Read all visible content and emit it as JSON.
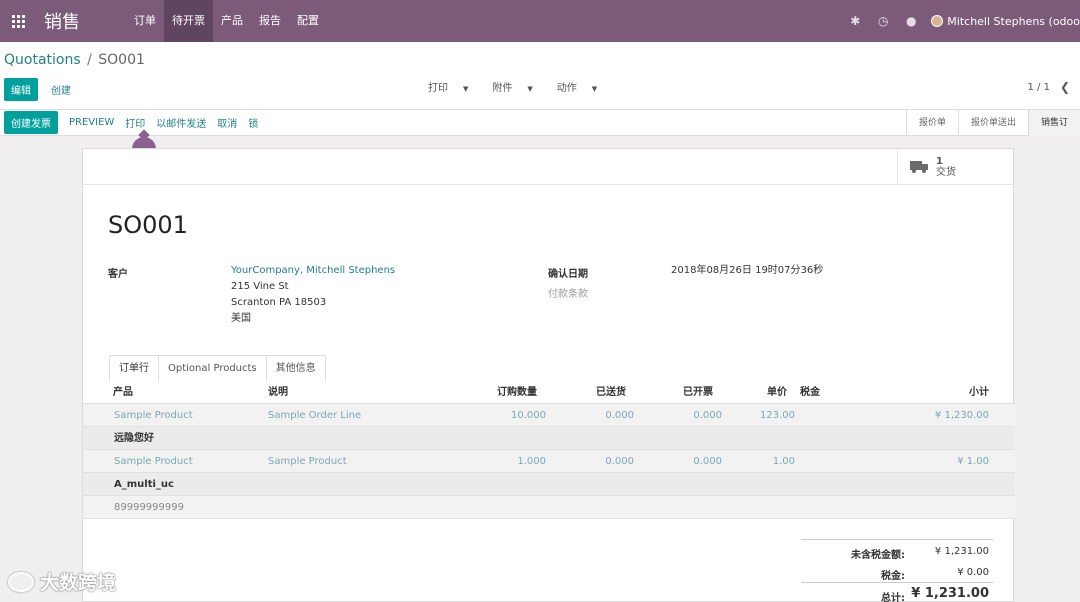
{
  "navbar": {
    "brand": "销售",
    "menu": [
      "订单",
      "待开票",
      "产品",
      "报告",
      "配置"
    ],
    "user": "Mitchell Stephens (odoo"
  },
  "breadcrumb": {
    "parent": "Quotations",
    "sep": "/",
    "current": "SO001"
  },
  "control": {
    "edit": "编辑",
    "create": "创建",
    "print": "打印",
    "attachment": "附件",
    "action": "动作",
    "pager": "1 / 1"
  },
  "statusbar": {
    "create_invoice": "创建发票",
    "preview": "PREVIEW",
    "print": "打印",
    "send_email": "以邮件发送",
    "cancel": "取消",
    "lock": "锁",
    "stages": [
      "报价单",
      "报价单送出",
      "销售订"
    ]
  },
  "smart_button": {
    "count": "1",
    "label": "交货"
  },
  "order": {
    "name": "SO001",
    "customer_label": "客户",
    "customer_name": "YourCompany, Mitchell Stephens",
    "address_line1": "215 Vine St",
    "address_line2": "Scranton PA 18503",
    "address_country": "美国",
    "confirm_date_label": "确认日期",
    "confirm_date": "2018年08月26日 19时07分36秒",
    "payment_terms_label": "付款条款"
  },
  "tabs": [
    "订单行",
    "Optional Products",
    "其他信息"
  ],
  "table": {
    "headers": {
      "product": "产品",
      "description": "说明",
      "qty": "订购数量",
      "delivered": "已送货",
      "invoiced": "已开票",
      "price": "单价",
      "tax": "税金",
      "subtotal": "小计"
    },
    "line1": {
      "product": "Sample Product",
      "description": "Sample Order Line",
      "qty": "10.000",
      "delivered": "0.000",
      "invoiced": "0.000",
      "price": "123.00",
      "subtotal": "¥ 1,230.00"
    },
    "section1": "远隐您好",
    "line2": {
      "product": "Sample Product",
      "description": "Sample Product",
      "qty": "1.000",
      "delivered": "0.000",
      "invoiced": "0.000",
      "price": "1.00",
      "subtotal": "¥ 1.00"
    },
    "section2": "A_multi_uc",
    "note": "89999999999"
  },
  "totals": {
    "untaxed_label": "未含税金额:",
    "untaxed": "¥ 1,231.00",
    "tax_label": "税金:",
    "tax": "¥ 0.00",
    "total_label": "总计:",
    "total": "¥ 1,231.00"
  },
  "watermark": "大数跨境",
  "colors": {
    "navbar": "#7c5a7a",
    "primary": "#00a09d",
    "link": "#21808a"
  }
}
